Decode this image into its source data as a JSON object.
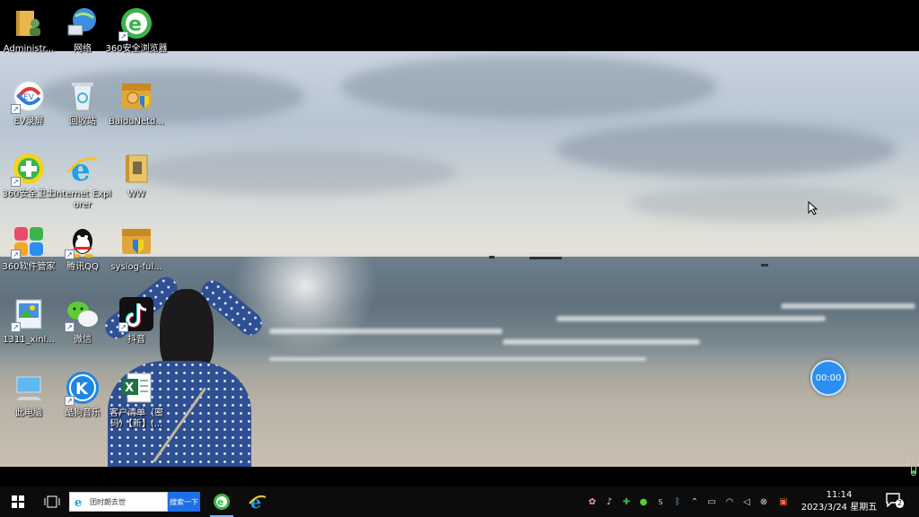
{
  "desktop": {
    "icons": [
      {
        "label": "Administr...",
        "icon": "user-folder-icon"
      },
      {
        "label": "网络",
        "icon": "network-icon"
      },
      {
        "label": "360安全浏览器",
        "icon": "360-browser-icon"
      },
      {
        "label": "EV录屏",
        "icon": "ev-recorder-icon"
      },
      {
        "label": "回收站",
        "icon": "recycle-bin-icon"
      },
      {
        "label": "BaiduNetd...",
        "icon": "baidu-netdisk-icon"
      },
      {
        "label": "360安全卫士",
        "icon": "360-safeguard-icon"
      },
      {
        "label": "Internet Explorer",
        "icon": "internet-explorer-icon"
      },
      {
        "label": "WW",
        "icon": "folder-icon"
      },
      {
        "label": "360软件管家",
        "icon": "360-software-manager-icon"
      },
      {
        "label": "腾讯QQ",
        "icon": "qq-icon"
      },
      {
        "label": "syslog-ful...",
        "icon": "installer-box-icon"
      },
      {
        "label": "1311_xinl...",
        "icon": "image-file-icon"
      },
      {
        "label": "微信",
        "icon": "wechat-icon"
      },
      {
        "label": "抖音",
        "icon": "douyin-icon"
      },
      {
        "label": "此电脑",
        "icon": "this-pc-icon"
      },
      {
        "label": "酷狗音乐",
        "icon": "kugou-music-icon"
      },
      {
        "label": "客户清单（密码）【新】(...",
        "icon": "excel-file-icon"
      }
    ],
    "timer": "00:00"
  },
  "taskbar": {
    "search_placeholder": "团时朗去世",
    "search_button": "搜索一下",
    "clock_time": "11:14",
    "clock_date": "2023/3/24 星期五",
    "notification_count": "2"
  },
  "colors": {
    "accent": "#1e6fe6",
    "taskbar": "#0c0c0c",
    "timer": "#2a8ff0"
  }
}
